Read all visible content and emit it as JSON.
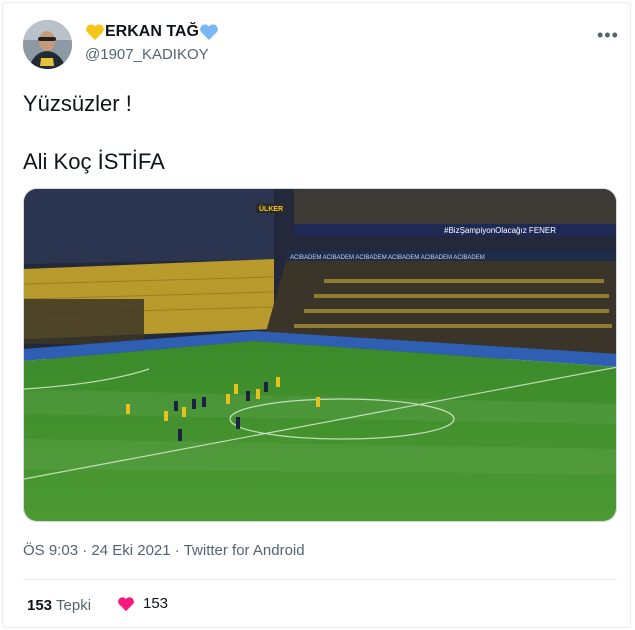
{
  "author": {
    "prefix_emoji": "yellow-heart",
    "name": "ERKAN TAĞ",
    "suffix_emoji": "blue-heart",
    "handle": "@1907_KADIKOY"
  },
  "tweet": {
    "line1": "Yüzsüzler !",
    "line2": "Ali Koç İSTİFA"
  },
  "media": {
    "stadium_sign_top": "ÜLKER",
    "banner_text": "#BizŞampiyonOlacağız  FENER",
    "sponsor_text": "ACIBADEM   ACIBADEM   ACIBADEM   ACIBADEM   ACIBADEM   ACIBADEM"
  },
  "meta": {
    "time": "ÖS 9:03",
    "date": "24 Eki 2021",
    "source": "Twitter for Android",
    "separator": "·"
  },
  "stats": {
    "reactions_count": "153",
    "reactions_label": "Tepki",
    "likes_count": "153"
  },
  "colors": {
    "like_heart": "#f91880",
    "yellow_heart": "#f5c518",
    "blue_heart": "#7ab8f5",
    "pitch": "#3f8f2c"
  }
}
